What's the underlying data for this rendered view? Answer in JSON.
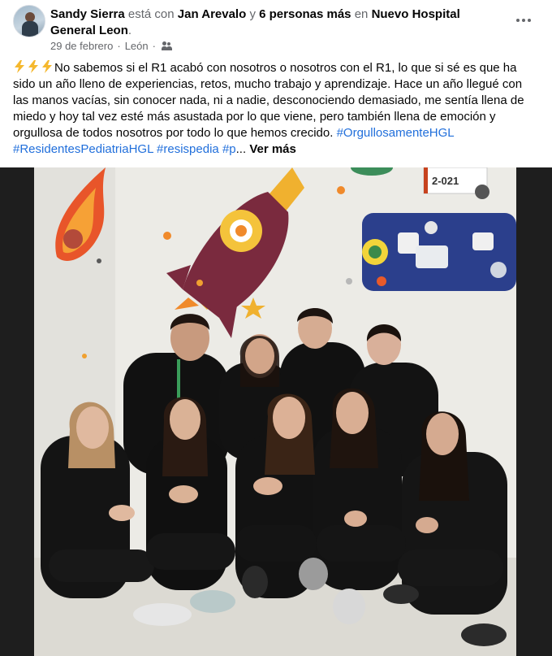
{
  "post": {
    "author": "Sandy Sierra",
    "with_text": "está con",
    "tagged_person": "Jan Arevalo",
    "and_text": "y",
    "others": "6 personas más",
    "in_text": "en",
    "place": "Nuevo Hospital General Leon",
    "end_punct": ".",
    "date": "29 de febrero",
    "separator": "·",
    "location": "León",
    "audience_icon": "friends-icon",
    "more_icon": "more-dots-icon"
  },
  "body": {
    "emoji": [
      "⚡",
      "⚡",
      "⚡"
    ],
    "text": "No sabemos si el R1 acabó con nosotros o nosotros con el R1, lo que si sé es que ha sido un año lleno de experiencias, retos, mucho trabajo y aprendizaje. Hace un año llegué con las manos vacías, sin conocer nada, ni a nadie, desconociendo demasiado, me sentía llena de miedo y hoy tal vez esté más asustada por lo que viene, pero también llena de emoción y orgullosa de todos nosotros por todo lo que hemos crecido. ",
    "hashtags": [
      "#OrgullosamenteHGL",
      "#ResidentesPediatriaHGL",
      "#resispedia",
      "#p"
    ],
    "ellipsis": "...",
    "see_more": "Ver más"
  },
  "photo": {
    "room_sign": "2-021"
  },
  "colors": {
    "link": "#216fdb",
    "secondary_text": "#65676b",
    "primary_text": "#050505",
    "letterbox": "#1e1e1e"
  }
}
